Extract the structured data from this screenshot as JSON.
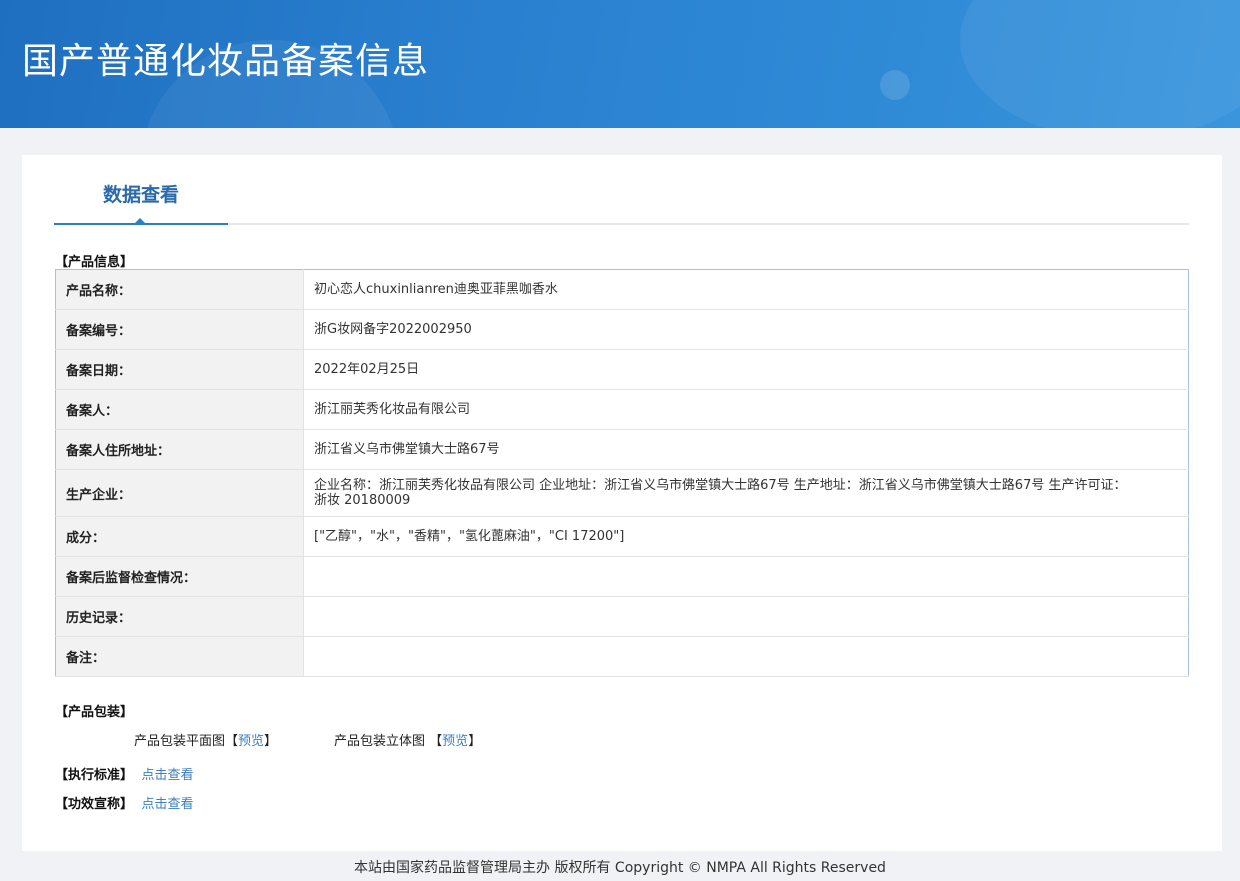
{
  "header": {
    "title": "国产普通化妆品备案信息"
  },
  "tab": {
    "label": "数据查看"
  },
  "sections": {
    "product_info": "【产品信息】",
    "packaging": "【产品包装】",
    "standard": "【执行标准】",
    "efficacy": "【功效宣称】"
  },
  "rows": [
    {
      "label": "产品名称：",
      "value": "初心恋人chuxinlianren迪奥亚菲黑咖香水"
    },
    {
      "label": "备案编号：",
      "value": "浙G妆网备字2022002950"
    },
    {
      "label": "备案日期：",
      "value": "2022年02月25日"
    },
    {
      "label": "备案人：",
      "value": "浙江丽芙秀化妆品有限公司"
    },
    {
      "label": "备案人住所地址：",
      "value": "浙江省义乌市佛堂镇大士路67号"
    },
    {
      "label": "生产企业：",
      "value": "企业名称：浙江丽芙秀化妆品有限公司 企业地址：浙江省义乌市佛堂镇大士路67号 生产地址：浙江省义乌市佛堂镇大士路67号 生产许可证：浙妆 20180009"
    },
    {
      "label": "成分：",
      "value": "[\"乙醇\"，\"水\"，\"香精\"，\"氢化蓖麻油\"，\"CI 17200\"]"
    },
    {
      "label": "备案后监督检查情况：",
      "value": ""
    },
    {
      "label": "历史记录：",
      "value": ""
    },
    {
      "label": "备注：",
      "value": ""
    }
  ],
  "packaging": {
    "flat_label": "产品包装平面图",
    "solid_label": "产品包装立体图",
    "preview": "预览",
    "lb": "【",
    "rb": "】"
  },
  "links": {
    "view": "点击查看"
  },
  "footer": "本站由国家药品监督管理局主办 版权所有 Copyright © NMPA All Rights Reserved"
}
